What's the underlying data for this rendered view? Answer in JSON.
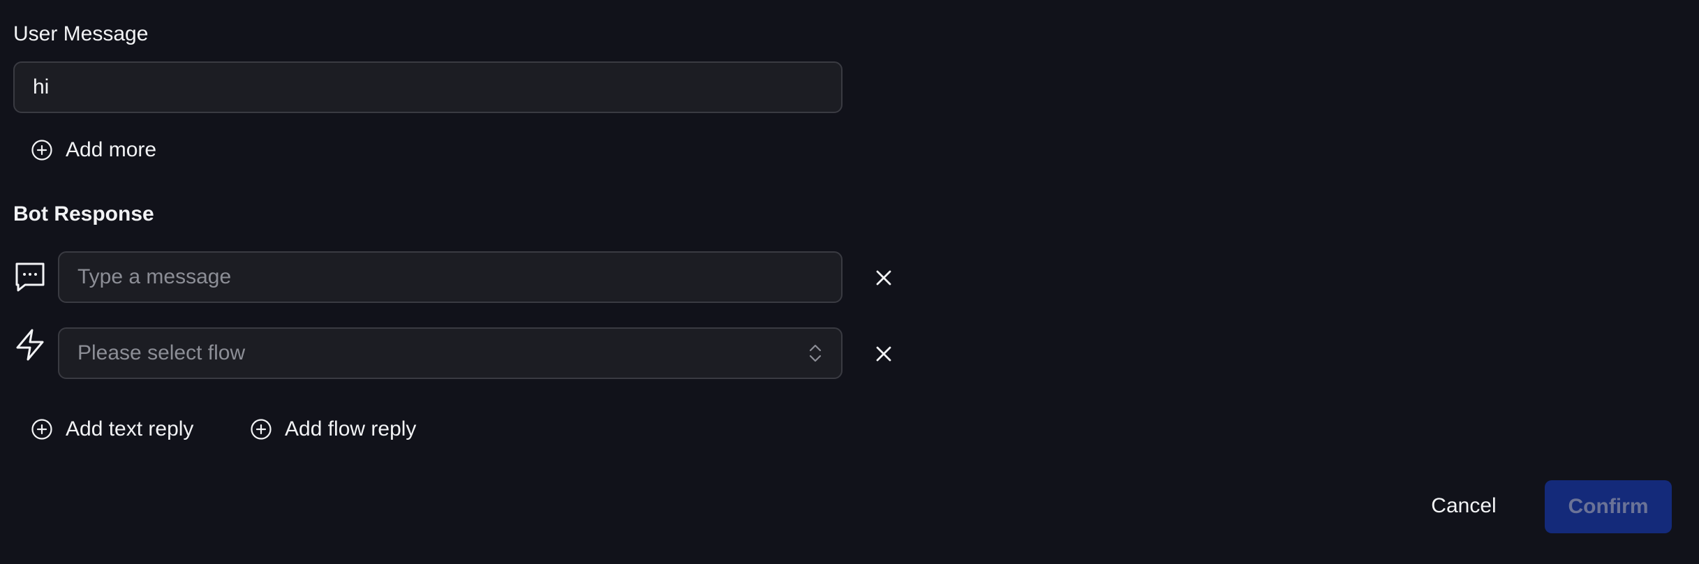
{
  "user_message": {
    "label": "User Message",
    "value": "hi",
    "add_more_label": "Add more"
  },
  "bot_response": {
    "label": "Bot Response",
    "text_reply": {
      "placeholder": "Type a message",
      "icon": "chat-bubble-icon"
    },
    "flow_reply": {
      "placeholder": "Please select flow",
      "icon": "lightning-bolt-icon"
    },
    "add_text_reply_label": "Add text reply",
    "add_flow_reply_label": "Add flow reply"
  },
  "actions": {
    "cancel_label": "Cancel",
    "confirm_label": "Confirm"
  },
  "colors": {
    "background": "#11121a",
    "field_background": "#1c1d23",
    "field_border": "#3a3b42",
    "confirm_background": "#142a7a",
    "confirm_text": "#6b7397"
  }
}
